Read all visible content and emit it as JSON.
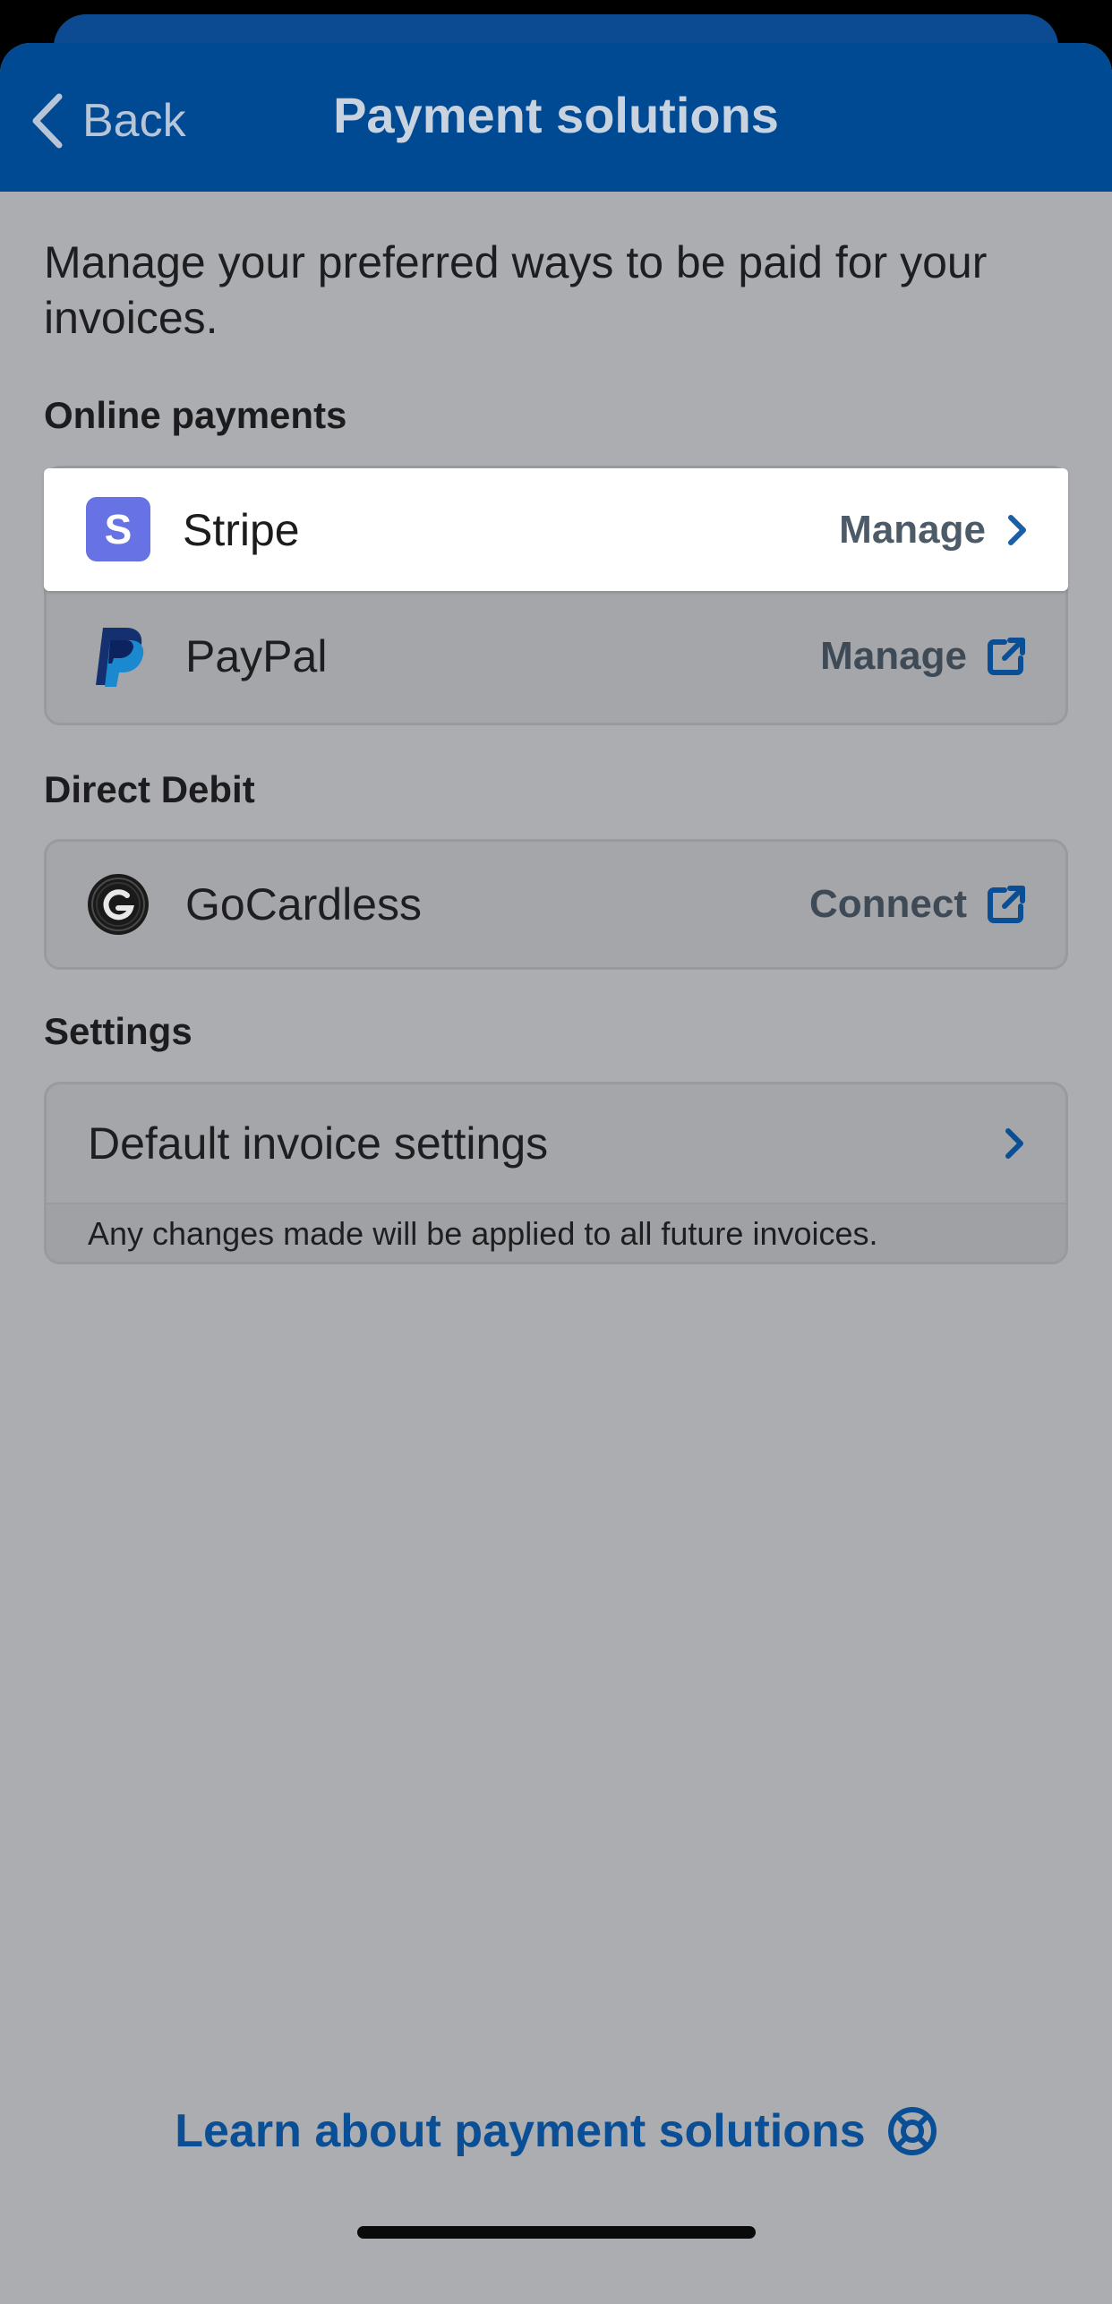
{
  "header": {
    "back_label": "Back",
    "title": "Payment solutions"
  },
  "intro_text": "Manage your preferred ways to be paid for your invoices.",
  "sections": {
    "online": {
      "title": "Online payments",
      "items": [
        {
          "name": "Stripe",
          "action": "Manage",
          "logo_icon": "stripe-logo-icon",
          "action_icon": "chevron-right-icon",
          "logo_letter": "S"
        },
        {
          "name": "PayPal",
          "action": "Manage",
          "logo_icon": "paypal-logo-icon",
          "action_icon": "external-link-icon"
        }
      ]
    },
    "direct_debit": {
      "title": "Direct Debit",
      "items": [
        {
          "name": "GoCardless",
          "action": "Connect",
          "logo_icon": "gocardless-logo-icon",
          "action_icon": "external-link-icon"
        }
      ]
    },
    "settings": {
      "title": "Settings",
      "item": {
        "name": "Default invoice settings",
        "action_icon": "chevron-right-icon"
      },
      "note": "Any changes made will be applied to all future invoices."
    }
  },
  "footer": {
    "learn_label": "Learn about payment solutions",
    "learn_icon": "lifebuoy-icon"
  },
  "colors": {
    "header_bg": "#004a94",
    "overlay_bg": "#acadb1",
    "accent": "#0a4f96",
    "stripe": "#6772e5"
  }
}
